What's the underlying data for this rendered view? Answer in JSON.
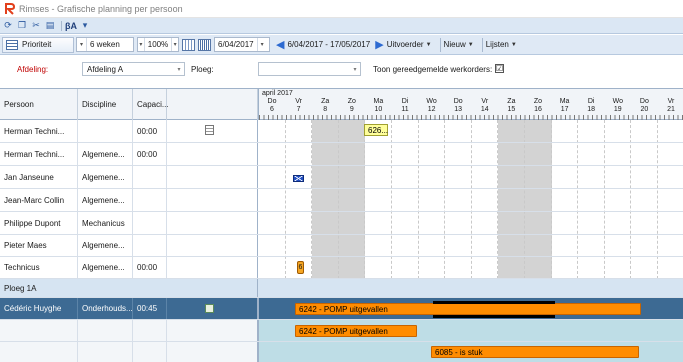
{
  "window": {
    "title": "Rimses - Grafische planning per persoon"
  },
  "toolbar": {
    "sort_label": "Prioriteit",
    "period_value": "6 weken",
    "zoom_value": "100%",
    "date_value": "6/04/2017",
    "range_label": "6/04/2017 - 17/05/2017",
    "menu_uitvoerder": "Uitvoerder",
    "menu_nieuw": "Nieuw",
    "menu_lijsten": "Lijsten"
  },
  "filters": {
    "afdeling_label": "Afdeling:",
    "afdeling_value": "Afdeling A",
    "ploeg_label": "Ploeg:",
    "ploeg_value": "",
    "toon_label": "Toon gereedgemelde werkorders:",
    "toon_checked": "☑"
  },
  "grid": {
    "columns": [
      "Persoon",
      "Discipline",
      "Capaci..."
    ],
    "timeline": {
      "month": "april 2017",
      "days": [
        {
          "name": "Do",
          "num": "6"
        },
        {
          "name": "Vr",
          "num": "7"
        },
        {
          "name": "Za",
          "num": "8"
        },
        {
          "name": "Zo",
          "num": "9"
        },
        {
          "name": "Ma",
          "num": "10"
        },
        {
          "name": "Di",
          "num": "11"
        },
        {
          "name": "Wo",
          "num": "12"
        },
        {
          "name": "Do",
          "num": "13"
        },
        {
          "name": "Vr",
          "num": "14"
        },
        {
          "name": "Za",
          "num": "15"
        },
        {
          "name": "Zo",
          "num": "16"
        },
        {
          "name": "Ma",
          "num": "17"
        },
        {
          "name": "Di",
          "num": "18"
        },
        {
          "name": "Wo",
          "num": "19"
        },
        {
          "name": "Do",
          "num": "20"
        },
        {
          "name": "Vr",
          "num": "21"
        }
      ]
    },
    "rows": [
      {
        "person": "Herman Techni...",
        "discipline": "",
        "capacity": "00:00"
      },
      {
        "person": "Herman Techni...",
        "discipline": "Algemene...",
        "capacity": "00:00"
      },
      {
        "person": "Jan Janseune",
        "discipline": "Algemene...",
        "capacity": ""
      },
      {
        "person": "Jean-Marc Collin",
        "discipline": "Algemene...",
        "capacity": ""
      },
      {
        "person": "Philippe Dupont",
        "discipline": "Mechanicus",
        "capacity": ""
      },
      {
        "person": "Pieter Maes",
        "discipline": "Algemene...",
        "capacity": ""
      },
      {
        "person": "Technicus",
        "discipline": "Algemene...",
        "capacity": "00:00"
      }
    ],
    "group": {
      "label": "Ploeg 1A"
    },
    "selected": {
      "person": "Cédéric Huyghe",
      "discipline": "Onderhouds...",
      "capacity": "00:45"
    },
    "tasks": {
      "yellow_label": "626...",
      "mini_label": "6",
      "task1_label": "6242 - POMP uitgevallen",
      "task2_label": "6242 - POMP uitgevallen",
      "task3_label": "6085 - is stuk"
    }
  },
  "colors": {
    "accent": "#3d6a93",
    "bar": "#ff8c00",
    "weekend": "#d3d3d3",
    "group": "#d6e4f2",
    "subrow": "#bedde6"
  }
}
